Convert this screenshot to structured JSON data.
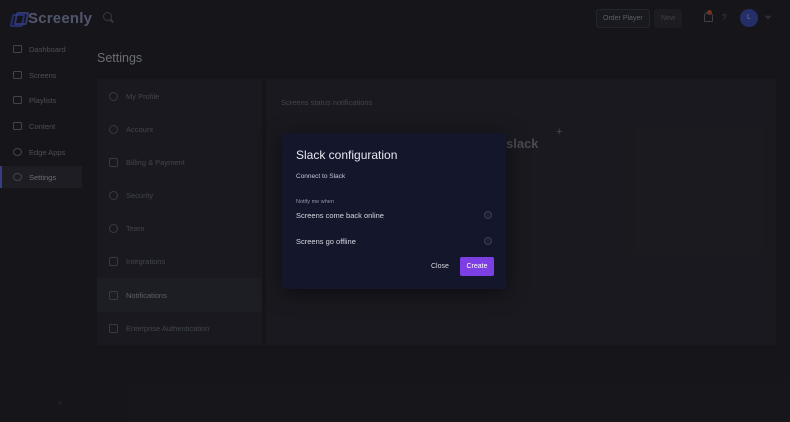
{
  "app": {
    "name": "Screenly"
  },
  "topbar": {
    "order_button": "Order Player",
    "new_button": "New",
    "avatar_initial": "L"
  },
  "sidebar": {
    "items": [
      {
        "label": "Dashboard",
        "icon": "dashboard-icon"
      },
      {
        "label": "Screens",
        "icon": "screens-icon"
      },
      {
        "label": "Playlists",
        "icon": "playlists-icon"
      },
      {
        "label": "Content",
        "icon": "content-icon"
      },
      {
        "label": "Edge Apps",
        "icon": "edge-apps-icon"
      },
      {
        "label": "Settings",
        "icon": "settings-icon",
        "active": true
      }
    ]
  },
  "settings": {
    "title": "Settings",
    "menu": [
      {
        "label": "My Profile"
      },
      {
        "label": "Account"
      },
      {
        "label": "Billing & Payment"
      },
      {
        "label": "Security"
      },
      {
        "label": "Team"
      },
      {
        "label": "Integrations"
      },
      {
        "label": "Notifications",
        "active": true
      },
      {
        "label": "Enterprise Authentication"
      }
    ],
    "content_title": "Screens status notifications",
    "slack_logo_text": "slack"
  },
  "modal": {
    "title": "Slack configuration",
    "subtitle": "Connect to Slack",
    "notify_label": "Notify me when",
    "options": [
      {
        "label": "Screens come back online"
      },
      {
        "label": "Screens go offline"
      }
    ],
    "close_label": "Close",
    "create_label": "Create"
  },
  "colors": {
    "accent": "#7b3fe4",
    "brand": "#3b4cc0",
    "modal_bg": "#14172b"
  }
}
